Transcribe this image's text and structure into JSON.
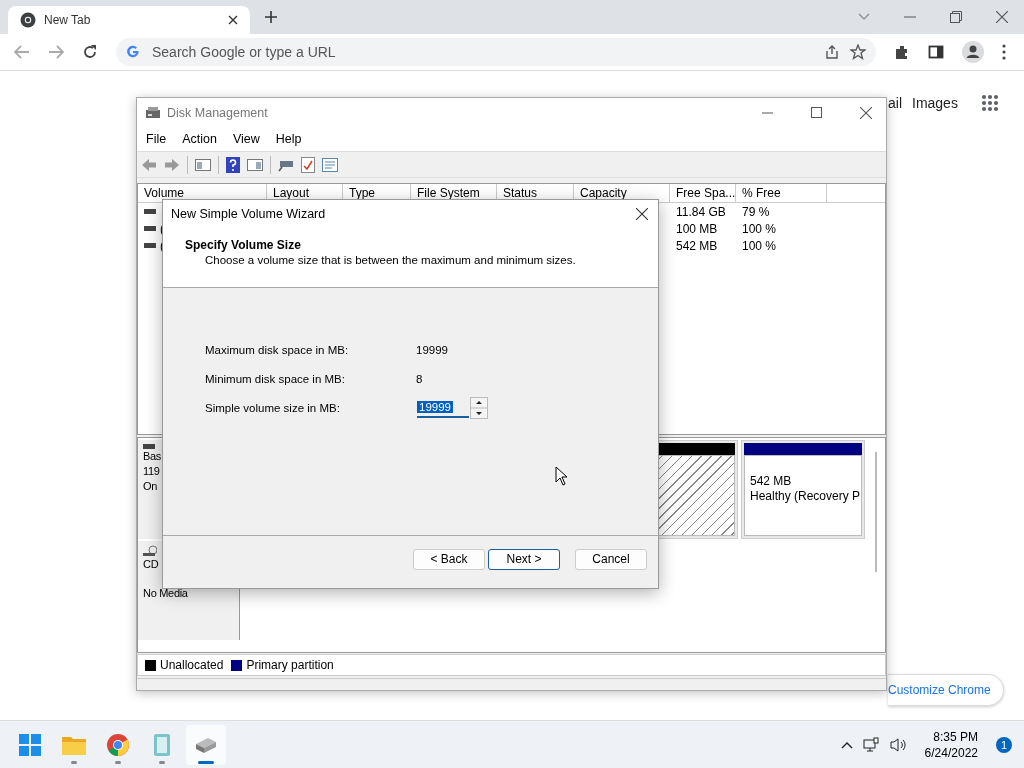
{
  "browser": {
    "tab": {
      "title": "New Tab"
    },
    "omnibox": {
      "placeholder": "Search Google or type a URL"
    }
  },
  "newtab": {
    "links": [
      "ail",
      "Images"
    ],
    "customize_button": "Customize Chrome"
  },
  "disk_management": {
    "title": "Disk Management",
    "menu": [
      "File",
      "Action",
      "View",
      "Help"
    ],
    "columns": [
      "Volume",
      "Layout",
      "Type",
      "File System",
      "Status",
      "Capacity",
      "Free Spa...",
      "% Free"
    ],
    "rows": [
      {
        "free": "11.84 GB",
        "percent": "79 %"
      },
      {
        "volume": "(",
        "free": "100 MB",
        "percent": "100 %"
      },
      {
        "volume": "(",
        "free": "542 MB",
        "percent": "100 %"
      }
    ],
    "disks": [
      {
        "kind": "basic",
        "lines": [
          "Bas",
          "119",
          "On"
        ],
        "partitions": [
          {
            "kind": "unallocated",
            "color": "#000000"
          },
          {
            "kind": "primary",
            "color": "#000080",
            "lines": [
              "542 MB",
              "Healthy (Recovery P"
            ]
          }
        ]
      },
      {
        "kind": "cdrom",
        "lines": [
          "CD",
          "No Media"
        ]
      }
    ],
    "legend": [
      {
        "label": "Unallocated",
        "color": "#000000"
      },
      {
        "label": "Primary partition",
        "color": "#000080"
      }
    ]
  },
  "wizard": {
    "title": "New Simple Volume Wizard",
    "heading": "Specify Volume Size",
    "subheading": "Choose a volume size that is between the maximum and minimum sizes.",
    "fields": [
      {
        "kind": "static",
        "label": "Maximum disk space in MB:",
        "value": "19999"
      },
      {
        "kind": "static",
        "label": "Minimum disk space in MB:",
        "value": "8"
      },
      {
        "kind": "spin",
        "label": "Simple volume size in MB:",
        "value": "19999",
        "selected": true
      }
    ],
    "buttons": [
      {
        "label": "< Back",
        "default": false
      },
      {
        "label": "Next >",
        "default": true
      },
      {
        "label": "Cancel",
        "default": false
      }
    ]
  },
  "taskbar": {
    "apps": [
      {
        "kind": "start",
        "running": false,
        "active": false
      },
      {
        "kind": "folder",
        "running": true,
        "active": false
      },
      {
        "kind": "chrome",
        "running": true,
        "active": false
      },
      {
        "kind": "notepad",
        "running": true,
        "active": false
      },
      {
        "kind": "disk",
        "running": true,
        "active": true
      }
    ],
    "time": "8:35 PM",
    "date": "6/24/2022",
    "badge": "1"
  }
}
